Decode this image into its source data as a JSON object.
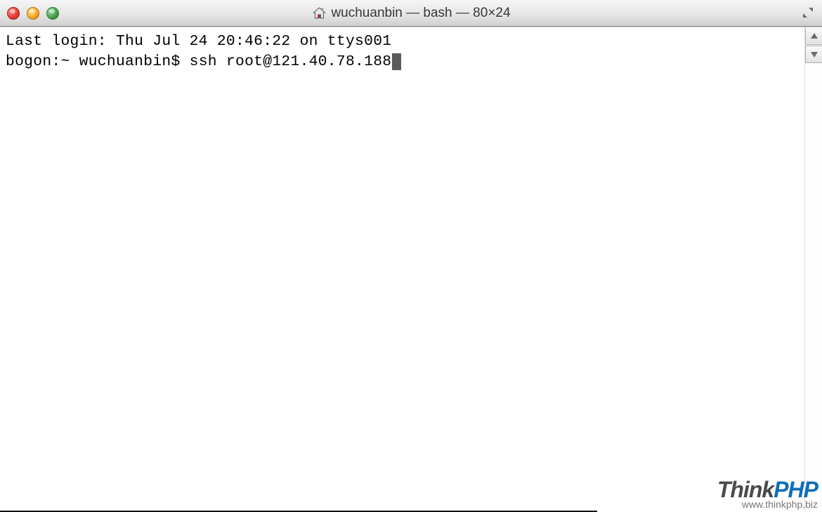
{
  "window": {
    "title": "wuchuanbin — bash — 80×24"
  },
  "terminal": {
    "lastLogin": "Last login: Thu Jul 24 20:46:22 on ttys001",
    "prompt": "bogon:~ wuchuanbin$ ",
    "command": "ssh root@121.40.78.188"
  },
  "watermark": {
    "brand_first": "Think",
    "brand_second": "PHP",
    "url": "www.thinkphp.biz"
  }
}
